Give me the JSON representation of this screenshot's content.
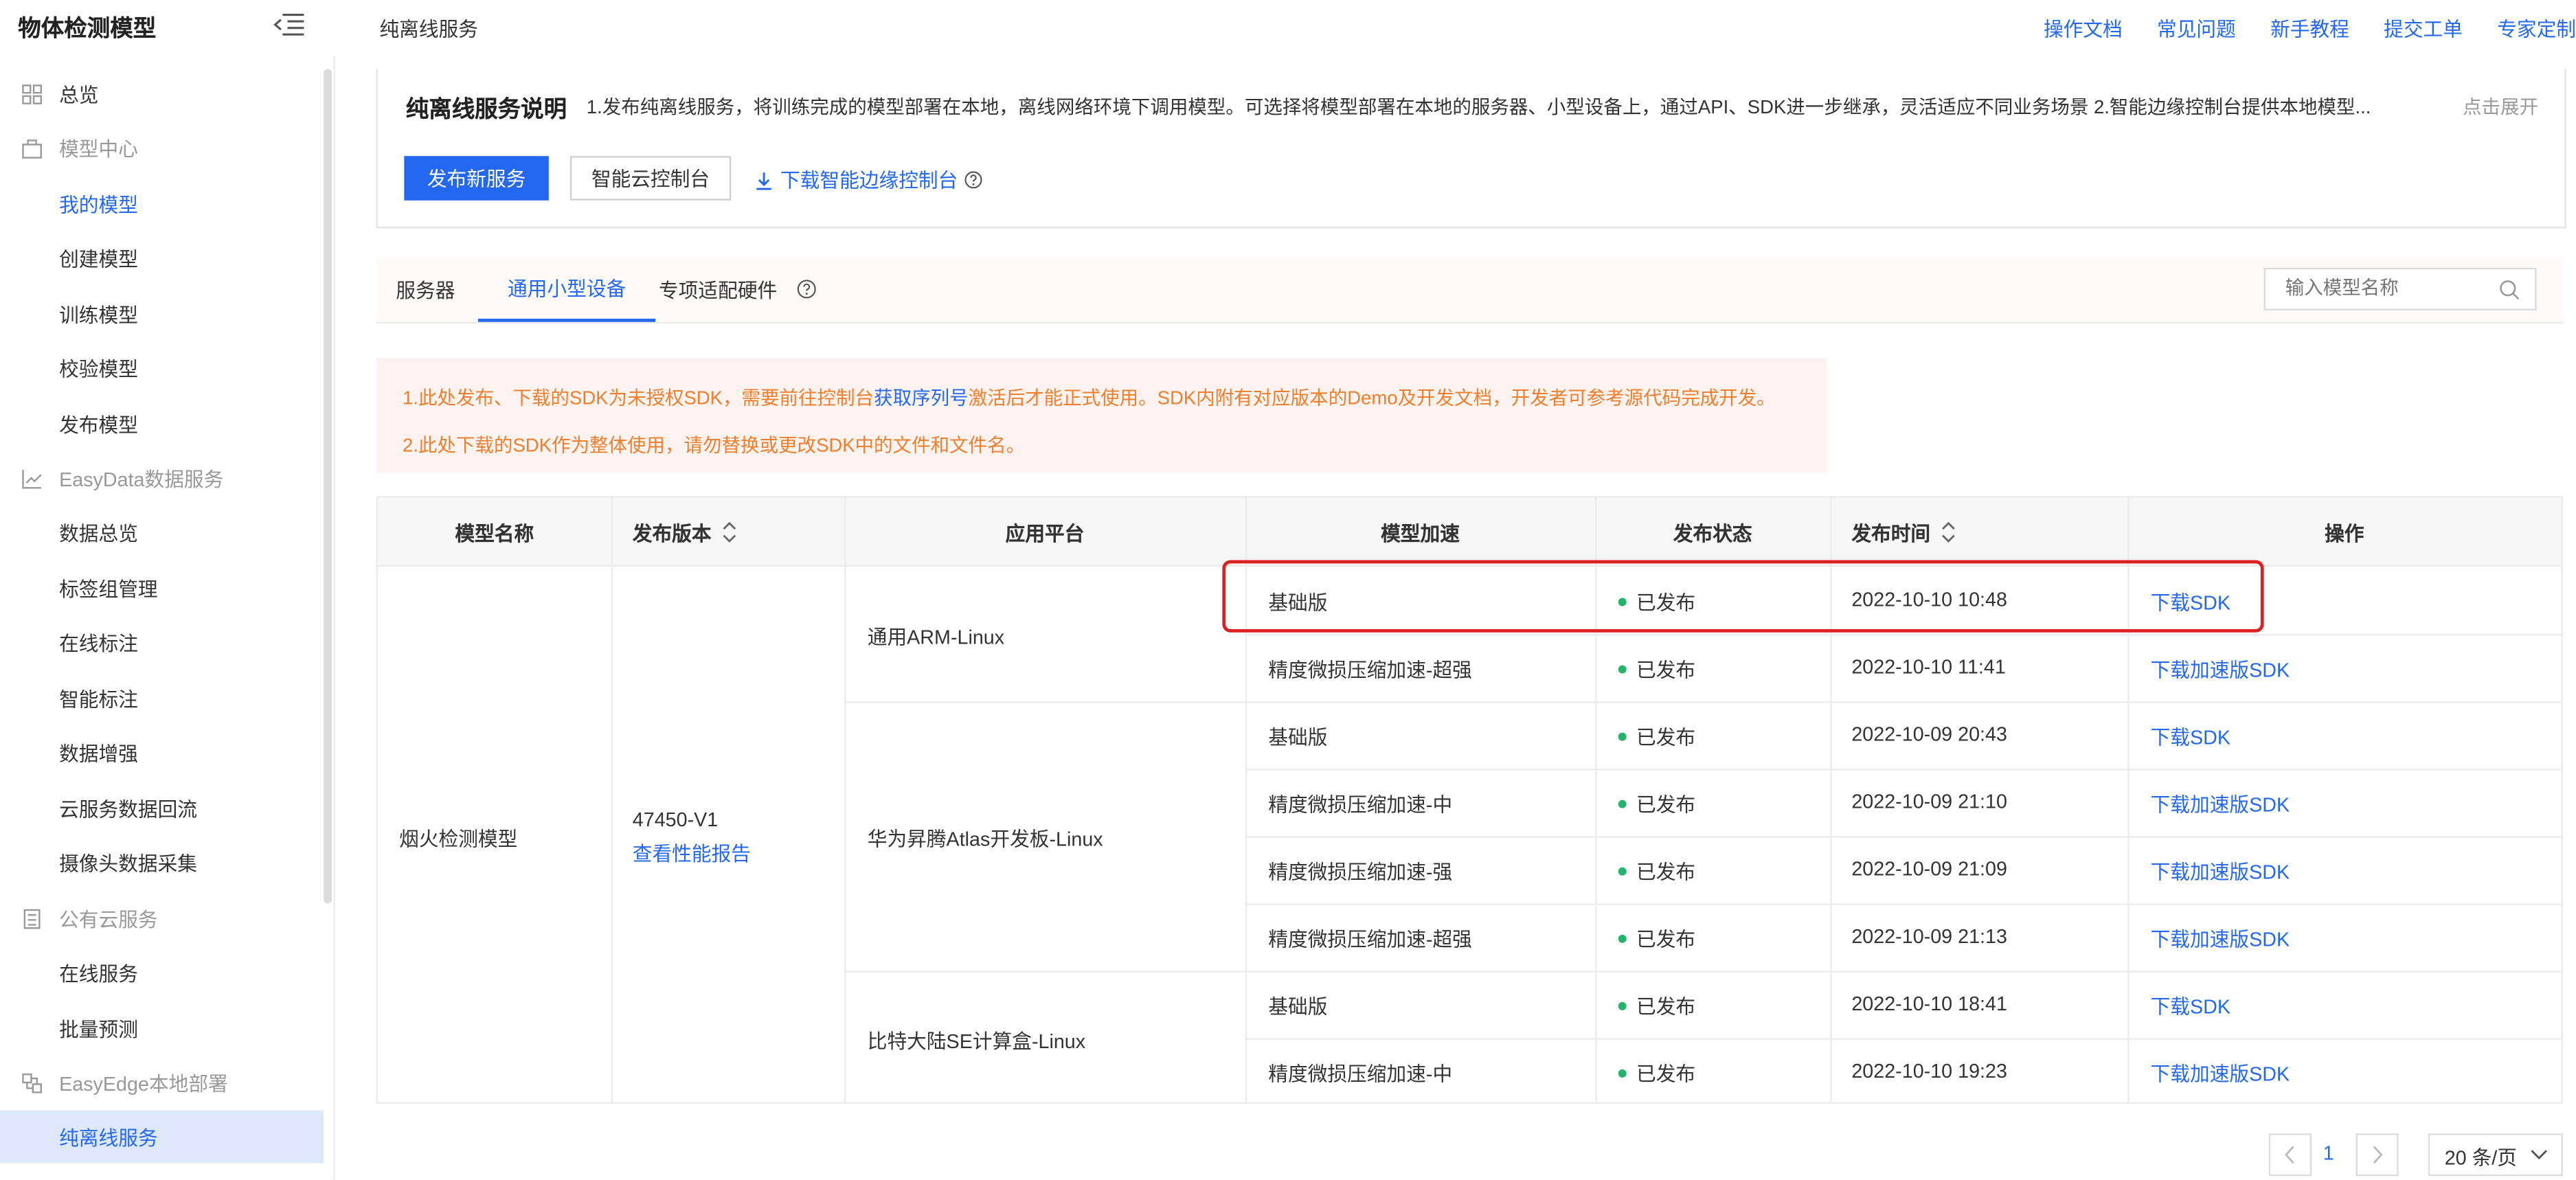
{
  "sidebar": {
    "title": "物体检测模型",
    "groups": [
      {
        "label": "总览",
        "icon": "grid-icon"
      },
      {
        "label": "模型中心",
        "icon": "model-icon"
      },
      {
        "label": "EasyData数据服务",
        "icon": "chart-icon"
      },
      {
        "label": "公有云服务",
        "icon": "server-icon"
      },
      {
        "label": "EasyEdge本地部署",
        "icon": "edge-icon"
      }
    ],
    "items": [
      "我的模型",
      "创建模型",
      "训练模型",
      "校验模型",
      "发布模型",
      "数据总览",
      "标签组管理",
      "在线标注",
      "智能标注",
      "数据增强",
      "云服务数据回流",
      "摄像头数据采集",
      "在线服务",
      "批量预测",
      "纯离线服务"
    ]
  },
  "header": {
    "breadcrumb": "纯离线服务",
    "links": [
      "操作文档",
      "常见问题",
      "新手教程",
      "提交工单",
      "专家定制"
    ]
  },
  "info": {
    "title": "纯离线服务说明",
    "desc": "1.发布纯离线服务，将训练完成的模型部署在本地，离线网络环境下调用模型。可选择将模型部署在本地的服务器、小型设备上，通过API、SDK进一步继承，灵活适应不同业务场景 2.智能边缘控制台提供本地模型...",
    "expand": "点击展开",
    "publish_btn": "发布新服务",
    "console_btn": "智能云控制台",
    "download_link": "下载智能边缘控制台"
  },
  "tabs": [
    "服务器",
    "通用小型设备",
    "专项适配硬件"
  ],
  "search": {
    "placeholder": "输入模型名称"
  },
  "notice": {
    "line1_a": "1.此处发布、下载的SDK为未授权SDK，需要前往控制台",
    "line1_link": "获取序列号",
    "line1_b": "激活后才能正式使用。SDK内附有对应版本的Demo及开发文档，开发者可参考源代码完成开发。",
    "line2": "2.此处下载的SDK作为整体使用，请勿替换或更改SDK中的文件和文件名。"
  },
  "table": {
    "columns": [
      "模型名称",
      "发布版本",
      "应用平台",
      "模型加速",
      "发布状态",
      "发布时间",
      "操作"
    ],
    "model_name": "烟火检测模型",
    "version": "47450-V1",
    "report_link": "查看性能报告",
    "platforms": [
      "通用ARM-Linux",
      "华为昇腾Atlas开发板-Linux",
      "比特大陆SE计算盒-Linux"
    ],
    "rows": [
      {
        "accel": "基础版",
        "status": "已发布",
        "time": "2022-10-10 10:48",
        "action": "下载SDK"
      },
      {
        "accel": "精度微损压缩加速-超强",
        "status": "已发布",
        "time": "2022-10-10 11:41",
        "action": "下载加速版SDK"
      },
      {
        "accel": "基础版",
        "status": "已发布",
        "time": "2022-10-09 20:43",
        "action": "下载SDK"
      },
      {
        "accel": "精度微损压缩加速-中",
        "status": "已发布",
        "time": "2022-10-09 21:10",
        "action": "下载加速版SDK"
      },
      {
        "accel": "精度微损压缩加速-强",
        "status": "已发布",
        "time": "2022-10-09 21:09",
        "action": "下载加速版SDK"
      },
      {
        "accel": "精度微损压缩加速-超强",
        "status": "已发布",
        "time": "2022-10-09 21:13",
        "action": "下载加速版SDK"
      },
      {
        "accel": "基础版",
        "status": "已发布",
        "time": "2022-10-10 18:41",
        "action": "下载SDK"
      },
      {
        "accel": "精度微损压缩加速-中",
        "status": "已发布",
        "time": "2022-10-10 19:23",
        "action": "下载加速版SDK"
      }
    ]
  },
  "pagination": {
    "current": "1",
    "page_size": "20 条/页"
  },
  "colors": {
    "accent": "#2468f2",
    "notice_text": "#f07f2d",
    "status_ok": "#26b36b",
    "highlight": "#e02020"
  }
}
